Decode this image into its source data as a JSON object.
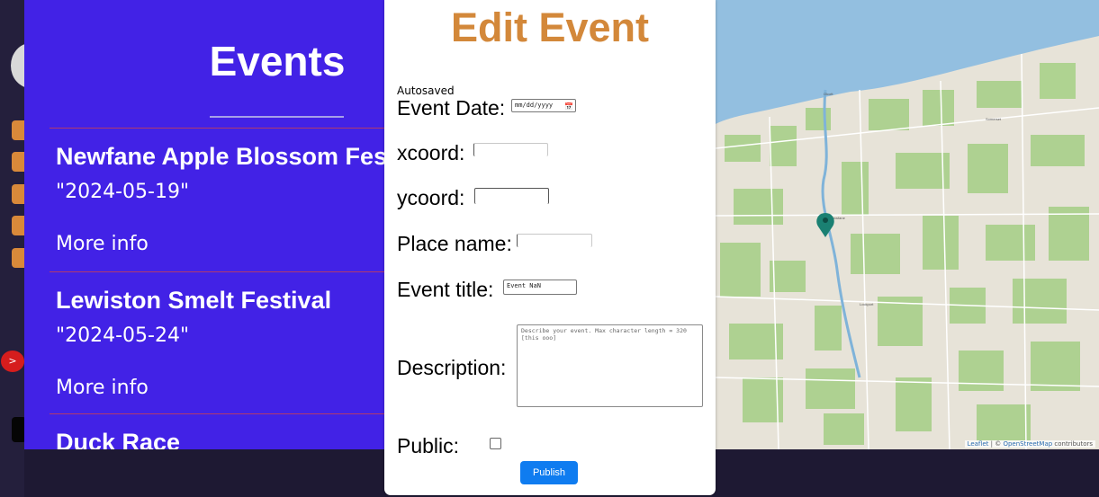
{
  "events_panel": {
    "title": "Events",
    "events": [
      {
        "title": "Newfane Apple Blossom Festival",
        "date": "\"2024-05-19\"",
        "more": "More info"
      },
      {
        "title": "Lewiston Smelt Festival",
        "date": "\"2024-05-24\"",
        "more": "More info"
      },
      {
        "title": "Duck Race"
      }
    ]
  },
  "sidebar": {
    "toggle_icon": ">"
  },
  "edit_form": {
    "title": "Edit Event",
    "status": "Autosaved",
    "event_date_label": "Event Date:",
    "event_date_placeholder": "mm/dd/yyyy",
    "xcoord_label": "xcoord:",
    "xcoord_value": "",
    "ycoord_label": "ycoord:",
    "ycoord_value": "",
    "place_label": "Place name:",
    "place_value": "",
    "title_label": "Event title:",
    "title_value": "Event NaN",
    "description_label": "Description:",
    "description_placeholder": "Describe your event. Max character length = 320 [this ooo]",
    "public_label": "Public:",
    "public_checked": false,
    "publish_label": "Publish"
  },
  "map": {
    "attribution_leaflet": "Leaflet",
    "attribution_sep": " | © ",
    "attribution_osm": "OpenStreetMap",
    "attribution_suffix": " contributors",
    "marker_icon": "map-pin-icon"
  }
}
